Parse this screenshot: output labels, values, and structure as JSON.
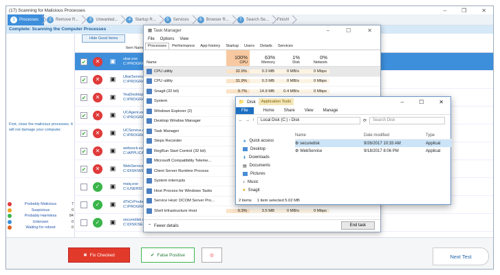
{
  "app": {
    "title": "(17) Scanning for Malicious Processes",
    "status": "Complete: Scanning the Computer Processes",
    "steps": [
      {
        "num": "1",
        "label": "Processes"
      },
      {
        "num": "2",
        "label": "Remove R..."
      },
      {
        "num": "3",
        "label": "Unwanted..."
      },
      {
        "num": "4",
        "label": "Startup R..."
      },
      {
        "num": "5",
        "label": "Services"
      },
      {
        "num": "6",
        "label": "Browser R..."
      },
      {
        "num": "7",
        "label": "Search Se..."
      },
      {
        "num": "",
        "label": "Finish!"
      }
    ],
    "left_message": "First, close the malicious processes. It will not damage your computer.",
    "stats": [
      {
        "label": "Probably Malicious",
        "value": "7",
        "color": "#e03a3a"
      },
      {
        "label": "Suspicious",
        "value": "0",
        "color": "#f0a020"
      },
      {
        "label": "Probably Harmless",
        "value": "84",
        "color": "#3ab54a"
      },
      {
        "label": "Unknown",
        "value": "0",
        "color": "#3b8fd9"
      },
      {
        "label": "Waiting for reboot",
        "value": "0",
        "color": "#e06020"
      }
    ],
    "hide_button": "Hide Good Items",
    "column_item_name": "Item Name",
    "rows": [
      {
        "name": "ubar.exe",
        "path": "C:\\PROGRAM",
        "sev": "red",
        "sel": true
      },
      {
        "name": "UbarService...",
        "path": "C:\\PROGRAM",
        "sev": "red"
      },
      {
        "name": "YeaDesktop...",
        "path": "C:\\PROGRAM",
        "sev": "red"
      },
      {
        "name": "UCAgent.exe",
        "path": "C:\\PROGRAM",
        "sev": "red"
      },
      {
        "name": "UCService.e...",
        "path": "C:\\PROGRAM",
        "sev": "red"
      },
      {
        "name": "websock.exe",
        "path": "C:\\APPLICAT",
        "sev": "red"
      },
      {
        "name": "WebService...",
        "path": "C:\\DISK\\WEB",
        "sev": "red"
      },
      {
        "name": "msiq.exe",
        "path": "C:\\USERS\\TE",
        "sev": "green"
      },
      {
        "name": "dTkCrPnubn...",
        "path": "C:\\PROGRAM",
        "sev": "green"
      },
      {
        "name": "securedisk.e...",
        "path": "C:\\DISK\\SECU",
        "sev": "green"
      }
    ],
    "buttons": {
      "fix": "Fix Checked",
      "false_positive": "False Positive",
      "next": "Next Test"
    }
  },
  "taskmanager": {
    "title": "Task Manager",
    "menu": [
      "File",
      "Options",
      "View"
    ],
    "tabs": [
      "Processes",
      "Performance",
      "App history",
      "Startup",
      "Users",
      "Details",
      "Services"
    ],
    "headers": {
      "name": "Name",
      "cpu_pct": "100%",
      "cpu": "CPU",
      "mem_pct": "63%",
      "mem": "Memory",
      "disk_pct": "1%",
      "disk": "Disk",
      "net_pct": "0%",
      "net": "Network"
    },
    "rows": [
      {
        "name": "CPU utility",
        "cpu": "32.9%",
        "mem": "0.3 MB",
        "disk": "0 MB/s",
        "net": "0 Mbps"
      },
      {
        "name": "CPU utility",
        "cpu": "31.9%",
        "mem": "0.3 MB",
        "disk": "0 MB/s",
        "net": "0 Mbps"
      },
      {
        "name": "Snagit (32 bit)",
        "cpu": "9.7%",
        "mem": "14.9 MB",
        "disk": "0.4 MB/s",
        "net": "0 Mbps"
      },
      {
        "name": "System",
        "cpu": "",
        "mem": "",
        "disk": "",
        "net": ""
      },
      {
        "name": "Windows Explorer (2)",
        "cpu": "",
        "mem": "",
        "disk": "",
        "net": ""
      },
      {
        "name": "Desktop Window Manager",
        "cpu": "",
        "mem": "",
        "disk": "",
        "net": ""
      },
      {
        "name": "Task Manager",
        "cpu": "",
        "mem": "",
        "disk": "",
        "net": ""
      },
      {
        "name": "Steps Recorder",
        "cpu": "",
        "mem": "",
        "disk": "",
        "net": ""
      },
      {
        "name": "RegRun Start Control (32 bit)",
        "cpu": "",
        "mem": "",
        "disk": "",
        "net": ""
      },
      {
        "name": "Microsoft Compatibility Teleme...",
        "cpu": "",
        "mem": "",
        "disk": "",
        "net": ""
      },
      {
        "name": "Client Server Runtime Process",
        "cpu": "",
        "mem": "",
        "disk": "",
        "net": ""
      },
      {
        "name": "System interrupts",
        "cpu": "",
        "mem": "",
        "disk": "",
        "net": ""
      },
      {
        "name": "Host Process for Windows Tasks",
        "cpu": "",
        "mem": "",
        "disk": "",
        "net": ""
      },
      {
        "name": "Service Host: DCOM Server Pro...",
        "cpu": "",
        "mem": "",
        "disk": "",
        "net": ""
      },
      {
        "name": "Shell Infrastructure Host",
        "cpu": "0.3%",
        "mem": "3.5 MB",
        "disk": "0 MB/s",
        "net": "0 Mbps"
      }
    ],
    "fewer_details": "Fewer details",
    "end_task": "End task"
  },
  "explorer": {
    "title": "Disk",
    "app_tools": "Application Tools",
    "ribbon": [
      "File",
      "Home",
      "Share",
      "View",
      "Manage"
    ],
    "path": "Local Disk (C:)  ›  Disk",
    "search_placeholder": "Search Disk",
    "nav": [
      "Quick access",
      "Desktop",
      "Downloads",
      "Documents",
      "Pictures",
      "Music",
      "Snagit"
    ],
    "col_name": "Name",
    "col_date": "Date modified",
    "col_type": "Type",
    "files": [
      {
        "name": "securedisk",
        "date": "9/26/2017 10:33 AM",
        "type": "Applicat",
        "sel": true
      },
      {
        "name": "WebService",
        "date": "9/18/2017 8:06 PM",
        "type": "Applicat"
      }
    ],
    "status_items": "2 items",
    "status_selected": "1 item selected  5.02 MB"
  }
}
